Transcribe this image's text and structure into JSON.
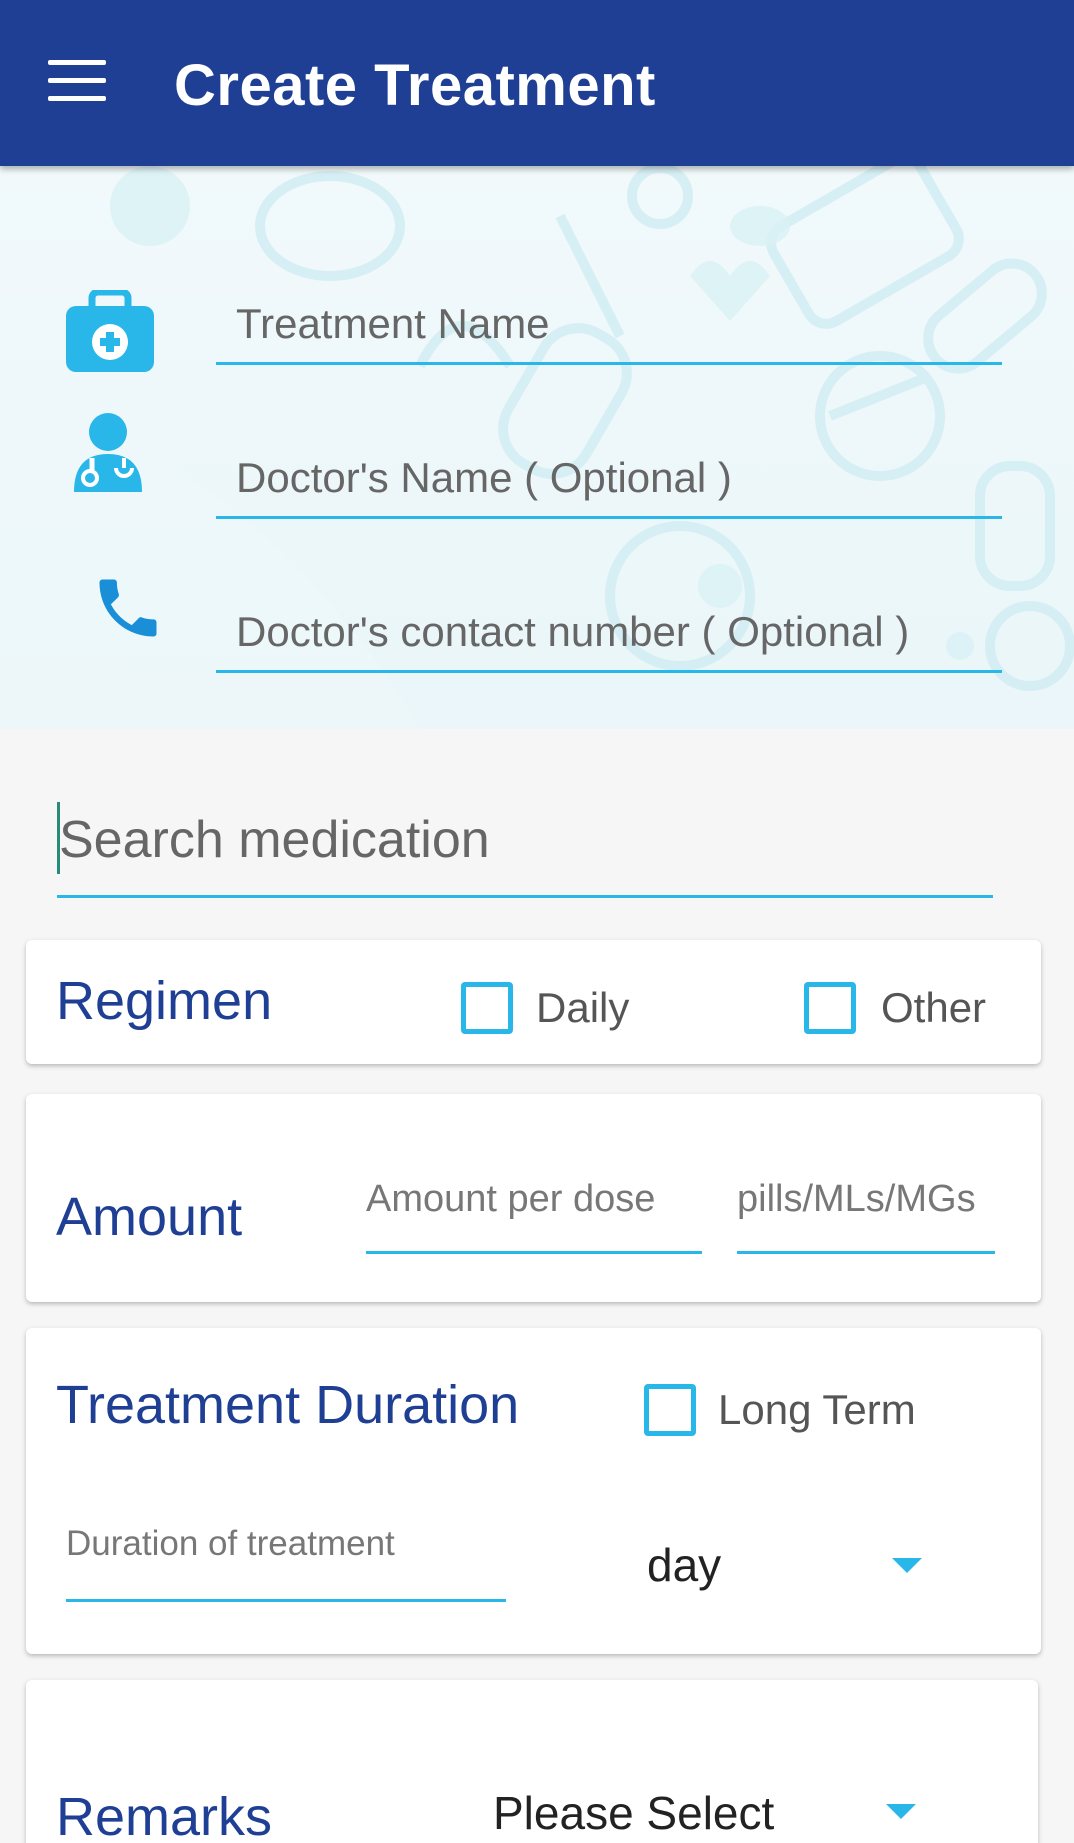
{
  "app_bar": {
    "title": "Create Treatment",
    "menu_icon": "hamburger-menu-icon",
    "color": "#1e3f94"
  },
  "header_fields": [
    {
      "icon": "medical-kit-icon",
      "placeholder": "Treatment Name"
    },
    {
      "icon": "doctor-icon",
      "placeholder": "Doctor's Name ( Optional )"
    },
    {
      "icon": "phone-icon",
      "placeholder": "Doctor's contact number ( Optional )"
    }
  ],
  "search": {
    "placeholder": "Search medication"
  },
  "regimen": {
    "title": "Regimen",
    "options": [
      {
        "label": "Daily",
        "checked": false
      },
      {
        "label": "Other",
        "checked": false
      }
    ]
  },
  "amount": {
    "title": "Amount",
    "dose_placeholder": "Amount per dose",
    "unit_placeholder": "pills/MLs/MGs"
  },
  "duration": {
    "title": "Treatment Duration",
    "long_term_label": "Long Term",
    "long_term_checked": false,
    "input_placeholder": "Duration of treatment",
    "unit_value": "day"
  },
  "remarks": {
    "title": "Remarks",
    "select_value": "Please Select"
  },
  "colors": {
    "accent": "#29b6e8",
    "title_blue": "#1e3f94"
  }
}
